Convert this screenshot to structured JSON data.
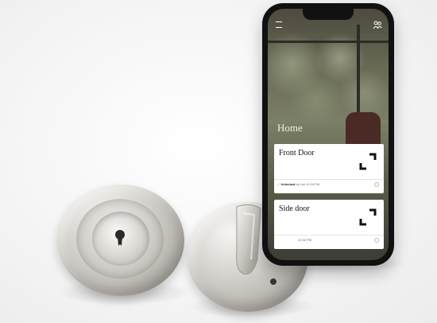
{
  "phone_app": {
    "home_title": "Home",
    "locks": [
      {
        "name": "Front Door",
        "status_state": "Unlocked",
        "status_detail": " by Lisi 10:24 PM"
      },
      {
        "name": "Side door",
        "status_state": "",
        "status_detail": "10:32 PM"
      }
    ]
  },
  "colors": {
    "metal_light": "#f2f1ef",
    "metal_dark": "#8f8b86",
    "phone_body": "#111111",
    "card_bg": "#ffffff"
  },
  "icons": {
    "lock_status": "bracket-lock-icon",
    "menu": "menu-icon",
    "people": "people-icon",
    "settings": "gear-icon"
  }
}
